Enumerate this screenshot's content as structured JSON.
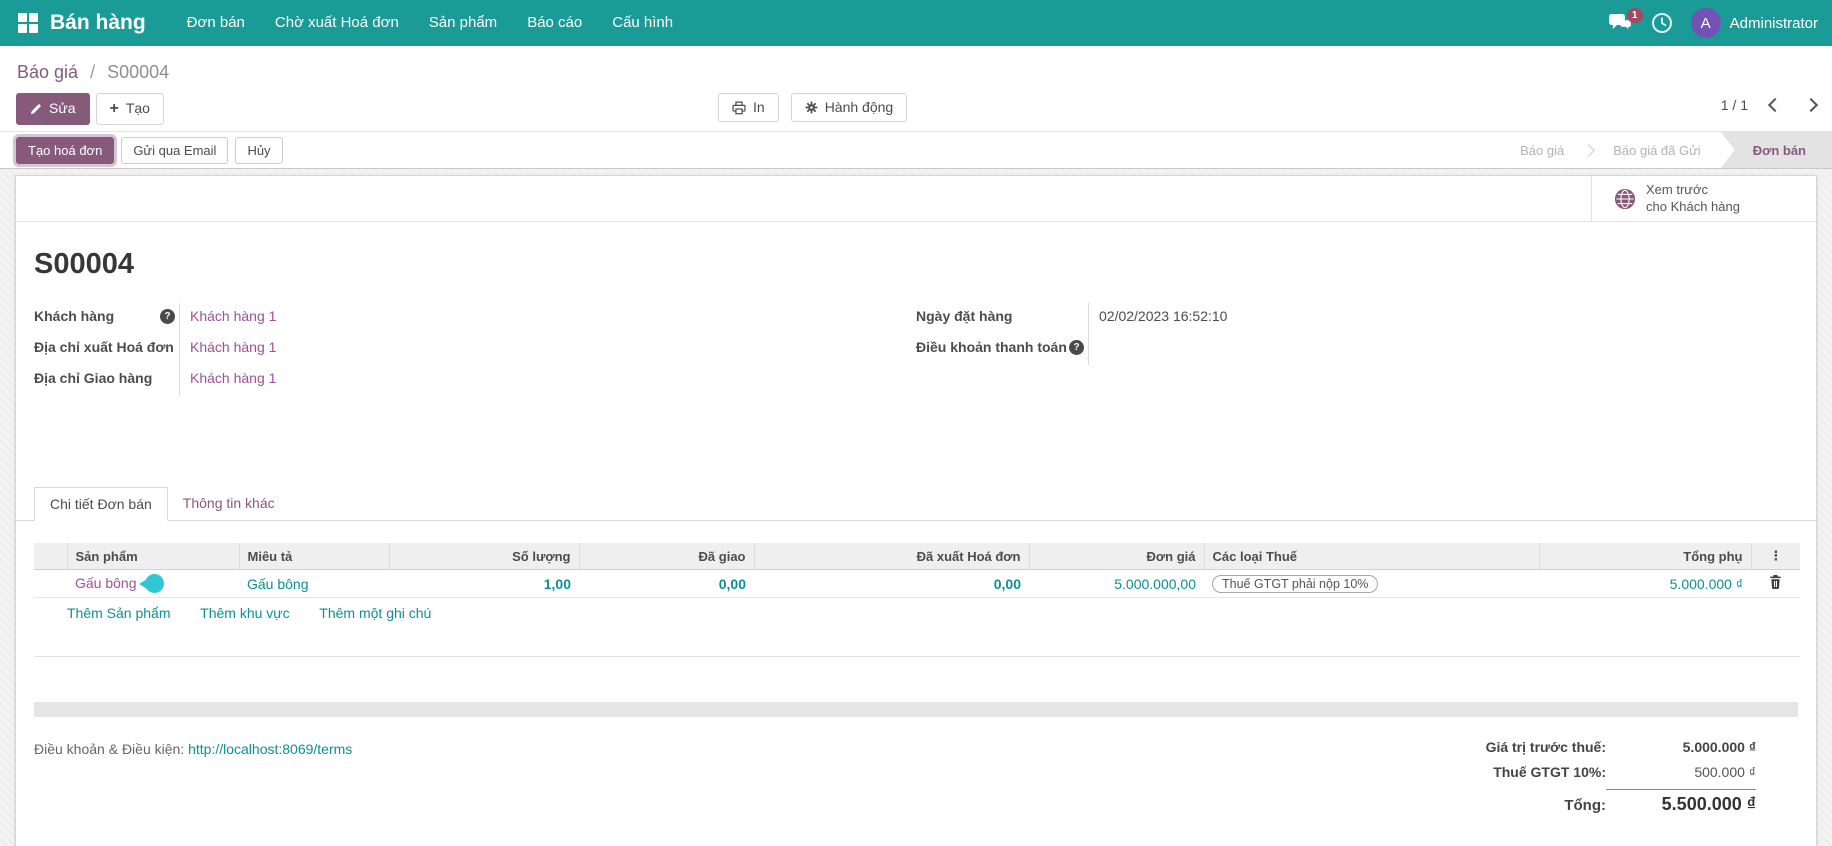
{
  "colors": {
    "navbar_teal": "#1a9b98",
    "primary_purple": "#875A7B",
    "link_teal": "#0d8f95",
    "product_magenta": "#9c5295",
    "badge_maroon": "#a24a5f",
    "avatar_purple": "#7352b5",
    "product_badge_cyan": "#31c6d4"
  },
  "icons": {
    "apps": "grid-icon",
    "messages": "chat-bubbles-icon",
    "activity": "clock-icon",
    "edit": "pencil-icon",
    "create": "plus-icon",
    "print": "printer-icon",
    "action": "gear-icon",
    "pager": "chevron-icons",
    "help": "question-circle-icon",
    "preview": "globe-icon",
    "column_toggle": "vertical-dots-icon",
    "delete": "trash-icon"
  },
  "navbar": {
    "brand": "Bán hàng",
    "menu_items": [
      "Đơn bán",
      "Chờ xuất Hoá đơn",
      "Sản phẩm",
      "Báo cáo",
      "Cấu hình"
    ],
    "messages_badge": "1",
    "user": {
      "initial": "A",
      "name": "Administrator"
    }
  },
  "breadcrumb": {
    "parent": "Báo giá",
    "divider": "/",
    "current": "S00004"
  },
  "control_panel": {
    "edit": "Sửa",
    "create": "Tạo",
    "print": "In",
    "action": "Hành động",
    "pager": "1 / 1"
  },
  "statusbar": {
    "action_buttons": [
      {
        "label": "Tạo hoá đơn",
        "style": "primary"
      },
      {
        "label": "Gửi qua Email",
        "style": "default"
      },
      {
        "label": "Hủy",
        "style": "default"
      }
    ],
    "steps": [
      {
        "label": "Báo giá",
        "state": "inactive"
      },
      {
        "label": "Báo giá đã Gửi",
        "state": "inactive"
      },
      {
        "label": "Đơn bán",
        "state": "active"
      }
    ]
  },
  "customer_preview": {
    "line1": "Xem trước",
    "line2": "cho Khách hàng"
  },
  "form": {
    "title": "S00004",
    "left_fields": [
      {
        "label": "Khách hàng",
        "value": "Khách hàng 1",
        "help": true
      },
      {
        "label": "Địa chỉ xuất Hoá đơn",
        "value": "Khách hàng 1",
        "help": false
      },
      {
        "label": "Địa chỉ Giao hàng",
        "value": "Khách hàng 1",
        "help": false
      }
    ],
    "right_fields": [
      {
        "label": "Ngày đặt hàng",
        "value": "02/02/2023 16:52:10",
        "help": false
      },
      {
        "label": "Điều khoản thanh toán",
        "value": "",
        "help": true
      }
    ]
  },
  "tabs": [
    {
      "label": "Chi tiết Đơn bán",
      "active": true
    },
    {
      "label": "Thông tin khác",
      "active": false
    }
  ],
  "order_lines": {
    "headers": {
      "product": "Sản phẩm",
      "description": "Miêu tả",
      "quantity": "Số lượng",
      "delivered": "Đã giao",
      "invoiced": "Đã xuất Hoá đơn",
      "unit_price": "Đơn giá",
      "taxes": "Các loại Thuế",
      "subtotal": "Tổng phụ"
    },
    "rows": [
      {
        "product": "Gấu bông",
        "description": "Gấu bông",
        "quantity": "1,00",
        "delivered": "0,00",
        "invoiced": "0,00",
        "unit_price": "5.000.000,00",
        "taxes": "Thuế GTGT phải nộp 10%",
        "subtotal": "5.000.000 ₫"
      }
    ],
    "add_links": [
      "Thêm Sản phẩm",
      "Thêm khu vực",
      "Thêm một ghi chú"
    ]
  },
  "footer": {
    "terms_label": "Điều khoản & Điều kiện:",
    "terms_url": "http://localhost:8069/terms",
    "totals": [
      {
        "label": "Giá trị trước thuế:",
        "value": "5.000.000 ₫",
        "emphasis": "bold"
      },
      {
        "label": "Thuế GTGT 10%:",
        "value": "500.000 ₫",
        "emphasis": "normal"
      },
      {
        "label": "Tổng:",
        "value": "5.500.000 ₫",
        "emphasis": "total"
      }
    ]
  }
}
